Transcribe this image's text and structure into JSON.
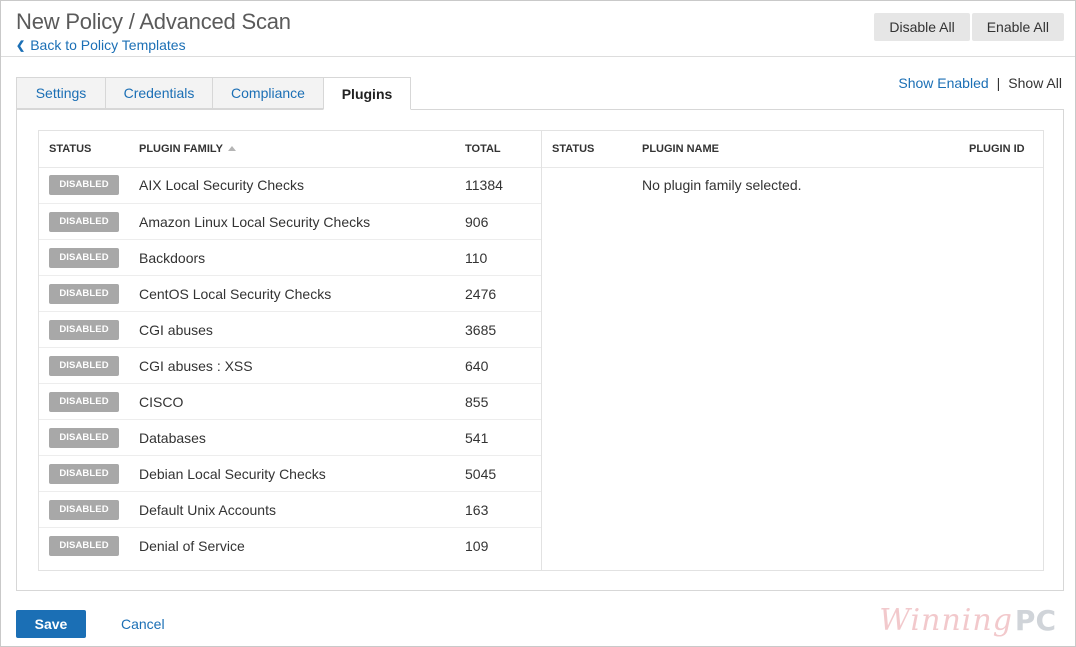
{
  "header": {
    "title": "New Policy / Advanced Scan",
    "back_label": "Back to Policy Templates",
    "disable_all_label": "Disable All",
    "enable_all_label": "Enable All"
  },
  "tabs": [
    {
      "label": "Settings",
      "active": false
    },
    {
      "label": "Credentials",
      "active": false
    },
    {
      "label": "Compliance",
      "active": false
    },
    {
      "label": "Plugins",
      "active": true
    }
  ],
  "filter": {
    "show_enabled": "Show Enabled",
    "separator": "|",
    "show_all": "Show All"
  },
  "families_table": {
    "columns": {
      "status": "STATUS",
      "family": "PLUGIN FAMILY",
      "total": "TOTAL"
    },
    "rows": [
      {
        "status": "DISABLED",
        "family": "AIX Local Security Checks",
        "total": "11384"
      },
      {
        "status": "DISABLED",
        "family": "Amazon Linux Local Security Checks",
        "total": "906"
      },
      {
        "status": "DISABLED",
        "family": "Backdoors",
        "total": "110"
      },
      {
        "status": "DISABLED",
        "family": "CentOS Local Security Checks",
        "total": "2476"
      },
      {
        "status": "DISABLED",
        "family": "CGI abuses",
        "total": "3685"
      },
      {
        "status": "DISABLED",
        "family": "CGI abuses : XSS",
        "total": "640"
      },
      {
        "status": "DISABLED",
        "family": "CISCO",
        "total": "855"
      },
      {
        "status": "DISABLED",
        "family": "Databases",
        "total": "541"
      },
      {
        "status": "DISABLED",
        "family": "Debian Local Security Checks",
        "total": "5045"
      },
      {
        "status": "DISABLED",
        "family": "Default Unix Accounts",
        "total": "163"
      },
      {
        "status": "DISABLED",
        "family": "Denial of Service",
        "total": "109"
      }
    ]
  },
  "plugins_table": {
    "columns": {
      "status": "STATUS",
      "name": "PLUGIN NAME",
      "id": "PLUGIN ID"
    },
    "empty_message": "No plugin family selected."
  },
  "footer": {
    "save_label": "Save",
    "cancel_label": "Cancel"
  },
  "watermark": {
    "script": "Winning",
    "suffix": "PC"
  },
  "colors": {
    "link": "#1b6fb5",
    "primary_button": "#1b6fb5",
    "disabled_badge": "#a8a8a8"
  }
}
